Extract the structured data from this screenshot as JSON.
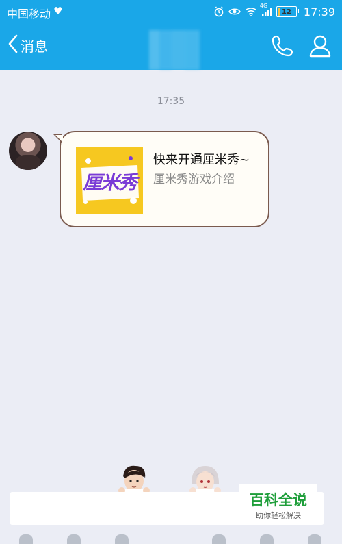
{
  "status_bar": {
    "carrier": "中国移动",
    "network": "4G",
    "battery": "12",
    "battery_level": 0.12,
    "time": "17:39"
  },
  "nav": {
    "back_label": "消息",
    "icons": [
      "chevron-left-icon",
      "phone-icon",
      "user-icon"
    ]
  },
  "chat": {
    "timestamp": "17:35",
    "card": {
      "image_text": "厘米秀",
      "title": "快来开通厘米秀~",
      "subtitle": "厘米秀游戏介绍"
    }
  },
  "watermark": {
    "title": "百科全说",
    "subtitle": "助你轻松解决"
  },
  "colors": {
    "header": "#1aa7e8",
    "background": "#ebedf5",
    "bubble_border": "#7a5a4e",
    "card_yellow": "#f6c820",
    "card_purple": "#7a3bd6",
    "watermark_green": "#1e9e3a"
  }
}
